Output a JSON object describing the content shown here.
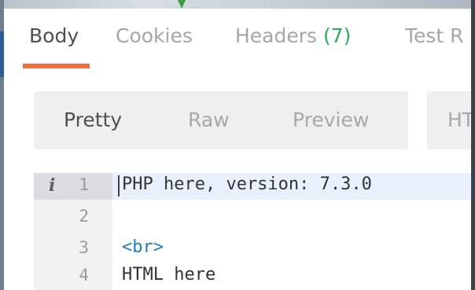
{
  "tabs": [
    {
      "label": "Body",
      "active": true
    },
    {
      "label": "Cookies"
    },
    {
      "label": "Headers",
      "count": "(7)"
    },
    {
      "label": "Test R"
    }
  ],
  "view_modes": [
    {
      "label": "Pretty",
      "active": true
    },
    {
      "label": "Raw"
    },
    {
      "label": "Preview"
    },
    {
      "label": "HT"
    }
  ],
  "editor": {
    "info_glyph": "i",
    "lines": [
      {
        "number": "1",
        "text": "PHP here, version: 7.3.0"
      },
      {
        "number": "2",
        "text": ""
      },
      {
        "number": "3",
        "text": "<br>"
      },
      {
        "number": "4",
        "text": "HTML here"
      }
    ]
  },
  "colors": {
    "active_tab_underline": "#f26b3a",
    "count_badge": "#2eaa5e",
    "html_tag": "#1f7fb5",
    "current_line": "#e8f0fb"
  }
}
